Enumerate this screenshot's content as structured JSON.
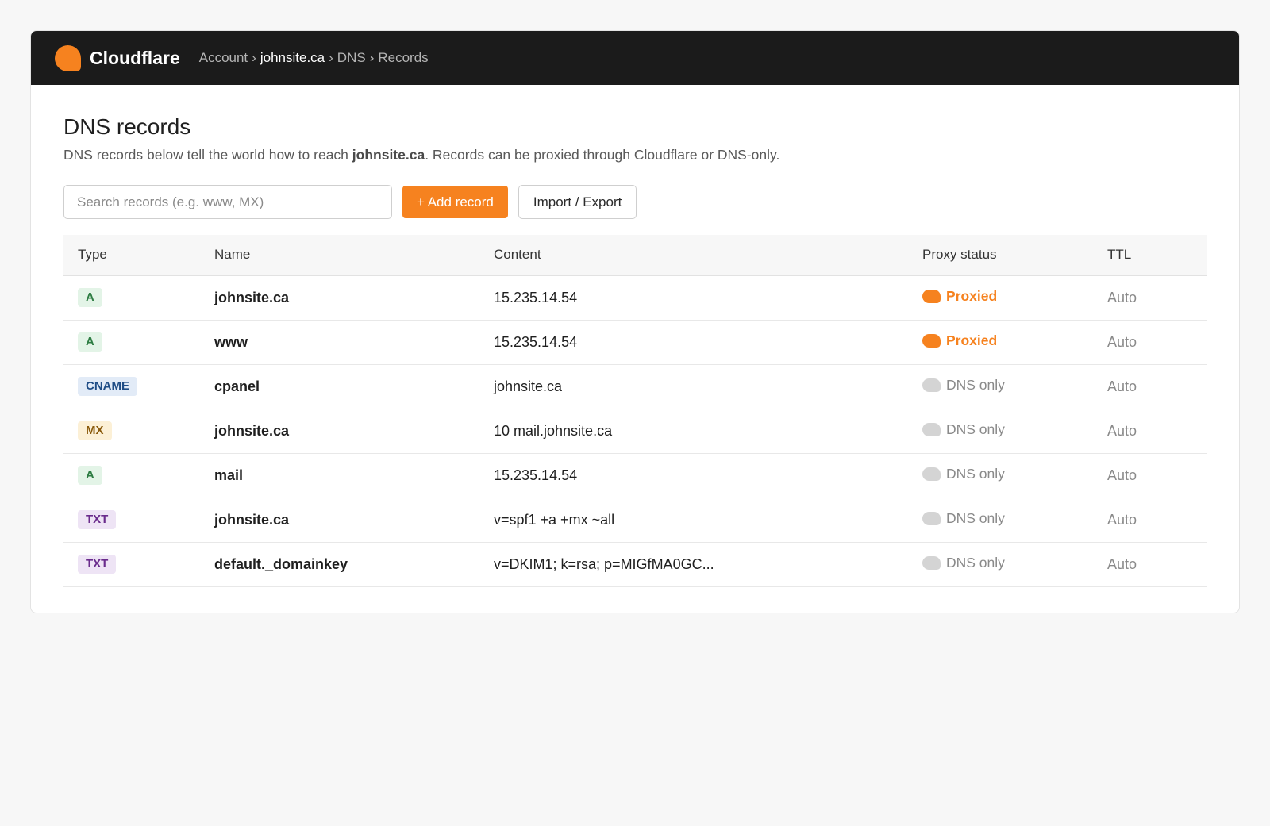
{
  "brand": {
    "name": "Cloudflare",
    "accent": "#f6821f"
  },
  "breadcrumb": [
    "Account",
    "johnsite.ca",
    "DNS",
    "Records"
  ],
  "breadcrumb_separator": "›",
  "page": {
    "title": "DNS records",
    "subtitle_before": "DNS records below tell the world how to reach ",
    "subtitle_domain": "johnsite.ca",
    "subtitle_after": ". Records can be proxied through Cloudflare or DNS-only."
  },
  "toolbar": {
    "search_placeholder": "Search records (e.g. www, MX)",
    "search_value": "",
    "add_label": "+ Add record",
    "import_label": "Import / Export"
  },
  "table": {
    "columns": [
      "Type",
      "Name",
      "Content",
      "Proxy status",
      "TTL"
    ],
    "rows": [
      {
        "type": "A",
        "name": "johnsite.ca",
        "content": "15.235.14.54",
        "proxy": "Proxied",
        "proxied": true,
        "ttl": "Auto"
      },
      {
        "type": "A",
        "name": "www",
        "content": "15.235.14.54",
        "proxy": "Proxied",
        "proxied": true,
        "ttl": "Auto"
      },
      {
        "type": "CNAME",
        "name": "cpanel",
        "content": "johnsite.ca",
        "proxy": "DNS only",
        "proxied": false,
        "ttl": "Auto"
      },
      {
        "type": "MX",
        "name": "johnsite.ca",
        "content": "10 mail.johnsite.ca",
        "proxy": "DNS only",
        "proxied": false,
        "ttl": "Auto"
      },
      {
        "type": "A",
        "name": "mail",
        "content": "15.235.14.54",
        "proxy": "DNS only",
        "proxied": false,
        "ttl": "Auto"
      },
      {
        "type": "TXT",
        "name": "johnsite.ca",
        "content": "v=spf1 +a +mx ~all",
        "proxy": "DNS only",
        "proxied": false,
        "ttl": "Auto"
      },
      {
        "type": "TXT",
        "name": "default._domainkey",
        "content": "v=DKIM1; k=rsa; p=MIGfMA0GC...",
        "proxy": "DNS only",
        "proxied": false,
        "ttl": "Auto"
      }
    ]
  }
}
